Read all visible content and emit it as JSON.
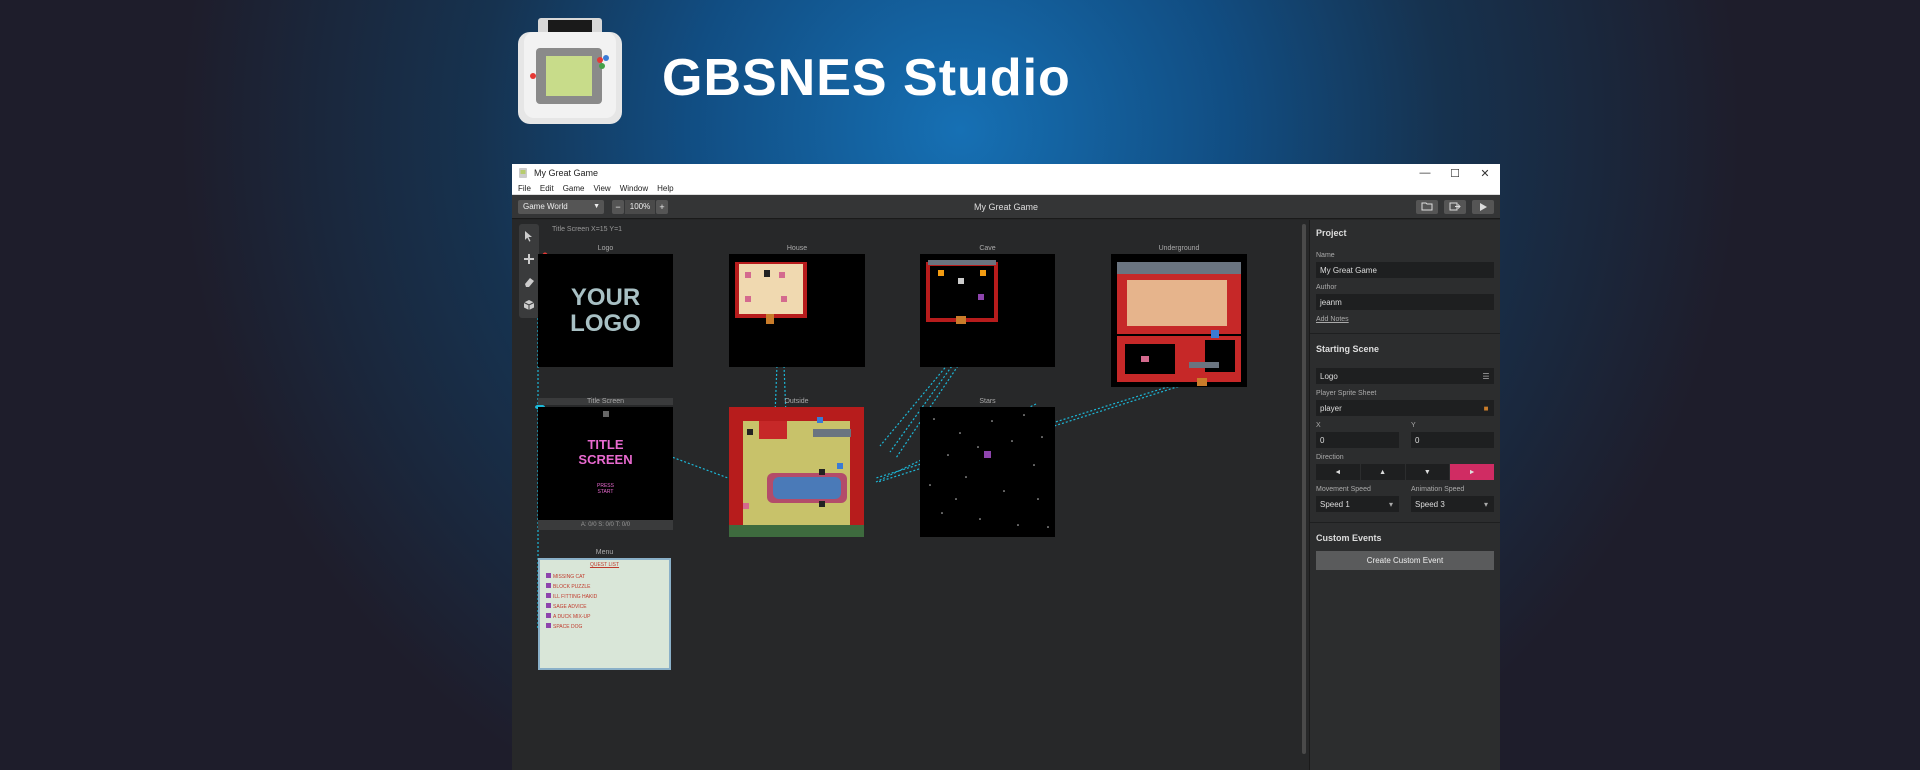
{
  "brand": {
    "title": "GBSNES Studio"
  },
  "window": {
    "title": "My Great Game",
    "controls": [
      "—",
      "☐",
      "✕"
    ]
  },
  "menu": [
    "File",
    "Edit",
    "Game",
    "View",
    "Window",
    "Help"
  ],
  "toolbar": {
    "view_select": "Game World",
    "zoom_minus": "−",
    "zoom_value": "100%",
    "zoom_plus": "+",
    "center_title": "My Great Game"
  },
  "canvas": {
    "coords": "Title Screen X=15 Y=1"
  },
  "scenes": {
    "logo": {
      "label": "Logo",
      "text_line1": "YOUR",
      "text_line2": "LOGO"
    },
    "house": {
      "label": "House"
    },
    "cave": {
      "label": "Cave"
    },
    "underground": {
      "label": "Underground"
    },
    "title_screen": {
      "label": "Title Screen",
      "text_line1": "TITLE",
      "text_line2": "SCREEN",
      "press1": "PRESS",
      "press2": "START",
      "info": "A: 0/0   S: 0/0   T: 0/0"
    },
    "outside": {
      "label": "Outside"
    },
    "stars": {
      "label": "Stars"
    },
    "menu": {
      "label": "Menu",
      "heading": "QUEST LIST",
      "items": [
        "MISSING CAT",
        "BLOCK PUZZLE",
        "ILL FITTING HAKID",
        "SAGE ADVICE",
        "A DUCK MIX-UP",
        "SPACE DOG"
      ]
    }
  },
  "sidebar": {
    "project_heading": "Project",
    "name_label": "Name",
    "name_value": "My Great Game",
    "author_label": "Author",
    "author_value": "jeanm",
    "notes_link": "Add Notes",
    "starting_heading": "Starting Scene",
    "scene_value": "Logo",
    "sprite_label": "Player Sprite Sheet",
    "sprite_value": "player",
    "x_label": "X",
    "x_value": "0",
    "y_label": "Y",
    "y_value": "0",
    "direction_label": "Direction",
    "directions": [
      "◄",
      "▲",
      "▼",
      "►"
    ],
    "movement_label": "Movement Speed",
    "movement_value": "Speed 1",
    "animation_label": "Animation Speed",
    "animation_value": "Speed 3",
    "custom_heading": "Custom Events",
    "create_button": "Create Custom Event"
  },
  "colors": {
    "accent": "#d02c63",
    "connector": "#1cb8d8"
  }
}
